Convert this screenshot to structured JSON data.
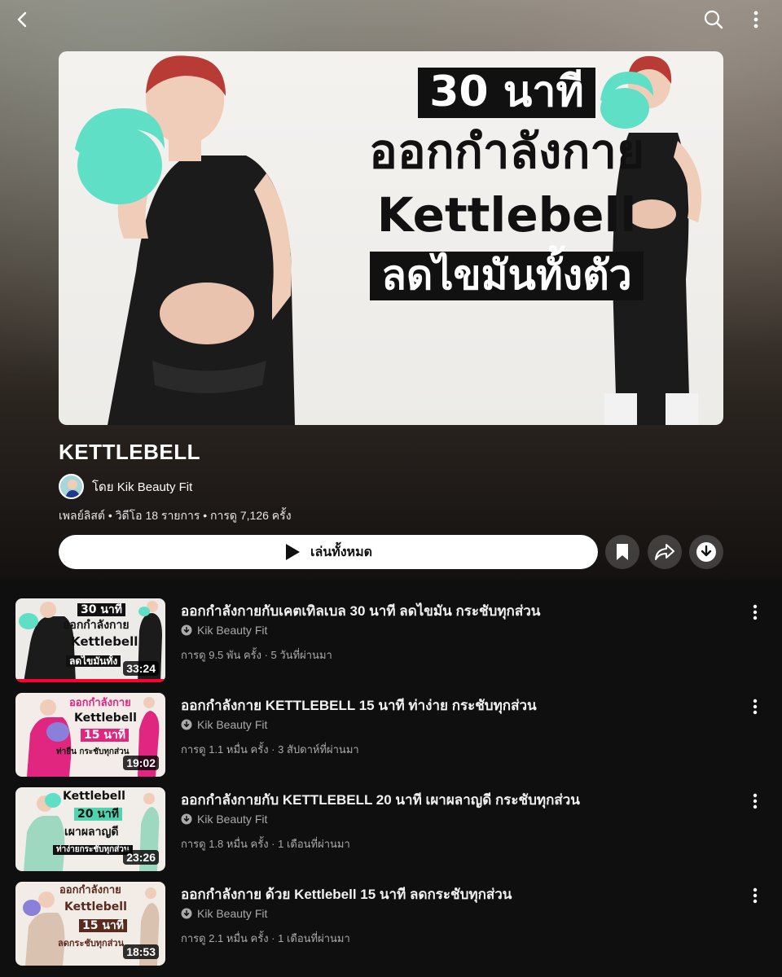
{
  "topbar": {
    "back_icon": "chevron-left-icon",
    "search_icon": "search-icon",
    "more_icon": "more-vertical-icon"
  },
  "hero": {
    "line1": "30 นาที",
    "line2": "ออกกำลังกาย",
    "line3": "Kettlebell",
    "line4": "ลดไขมันทั้งตัว",
    "colors": {
      "kettlebell": "#5fe0c6",
      "outfit": "#1b1b1b",
      "background": "#efeeeb"
    }
  },
  "playlist": {
    "title": "KETTLEBELL",
    "owner": "โดย Kik Beauty Fit",
    "meta": "เพลย์ลิสต์ • วิดีโอ 18 รายการ • การดู 7,126 ครั้ง",
    "play_all_label": "เล่นทั้งหมด"
  },
  "actions": [
    "bookmark-icon",
    "share-icon",
    "download-icon"
  ],
  "videos": [
    {
      "title": "ออกกำลังกายกับเคตเทิลเบล 30 นาที ลดไขมัน กระชับทุกส่วน",
      "channel": "Kik Beauty Fit",
      "meta": "การดู 9.5 พัน ครั้ง · 5 วันที่ผ่านมา",
      "duration": "33:24",
      "thumb_lines": [
        "30 นาที",
        "ออกกำลังกาย",
        "Kettlebell",
        "ลดไขมันทั้ง"
      ],
      "accent": "#111111",
      "watched": 1.0
    },
    {
      "title": "ออกกำลังกาย KETTLEBELL 15 นาที ท่าง่าย กระชับทุกส่วน",
      "channel": "Kik Beauty Fit",
      "meta": "การดู 1.1 หมื่น ครั้ง · 3 สัปดาห์ที่ผ่านมา",
      "duration": "19:02",
      "thumb_lines": [
        "ออกกำลังกาย",
        "Kettlebell",
        "15 นาที",
        "ท่ายืน กระชับทุกส่วน"
      ],
      "accent": "#e0267f",
      "watched": 0
    },
    {
      "title": "ออกกำลังกายกับ KETTLEBELL 20 นาที เผาผลาญดี กระชับทุกส่วน",
      "channel": "Kik Beauty Fit",
      "meta": "การดู 1.8 หมื่น ครั้ง · 1 เดือนที่ผ่านมา",
      "duration": "23:26",
      "thumb_lines": [
        "Kettlebell",
        "20 นาที",
        "เผาผลาญดี",
        "ท่าง่ายกระชับทุกส่วน"
      ],
      "accent": "#4fd3b0",
      "watched": 0
    },
    {
      "title": "ออกกำลังกาย ด้วย Kettlebell 15 นาที ลดกระชับทุกส่วน",
      "channel": "Kik Beauty Fit",
      "meta": "การดู 2.1 หมื่น ครั้ง · 1 เดือนที่ผ่านมา",
      "duration": "18:53",
      "thumb_lines": [
        "ออกกำลังกาย",
        "Kettlebell",
        "15 นาที",
        "ลดกระชับทุกส่วน"
      ],
      "accent": "#5a2a1e",
      "watched": 0
    }
  ]
}
